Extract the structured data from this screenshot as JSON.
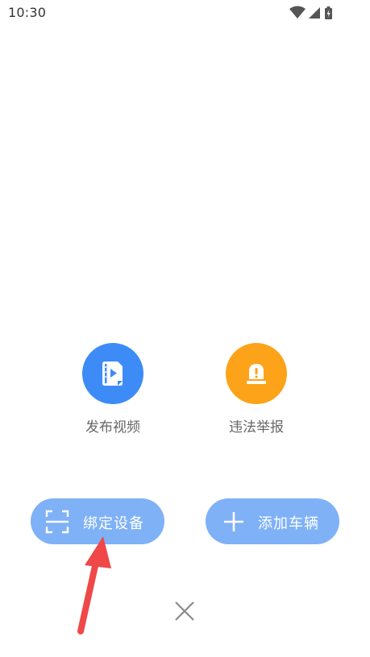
{
  "status_bar": {
    "time": "10:30",
    "icons": [
      "wifi-icon",
      "cellular-signal-icon",
      "battery-charging-icon"
    ]
  },
  "quick_actions": [
    {
      "label": "发布视频",
      "icon": "video-file-icon",
      "color": "#3d8bf7"
    },
    {
      "label": "违法举报",
      "icon": "alarm-light-icon",
      "color": "#fda319"
    }
  ],
  "buttons": {
    "bind_device": {
      "label": "绑定设备",
      "icon": "scan-icon"
    },
    "add_vehicle": {
      "label": "添加车辆",
      "icon": "plus-icon"
    },
    "close": {
      "icon": "close-icon"
    }
  },
  "colors": {
    "pill_background": "#7fb1f7",
    "label_text": "#666666",
    "annotation_arrow": "#f04848"
  }
}
